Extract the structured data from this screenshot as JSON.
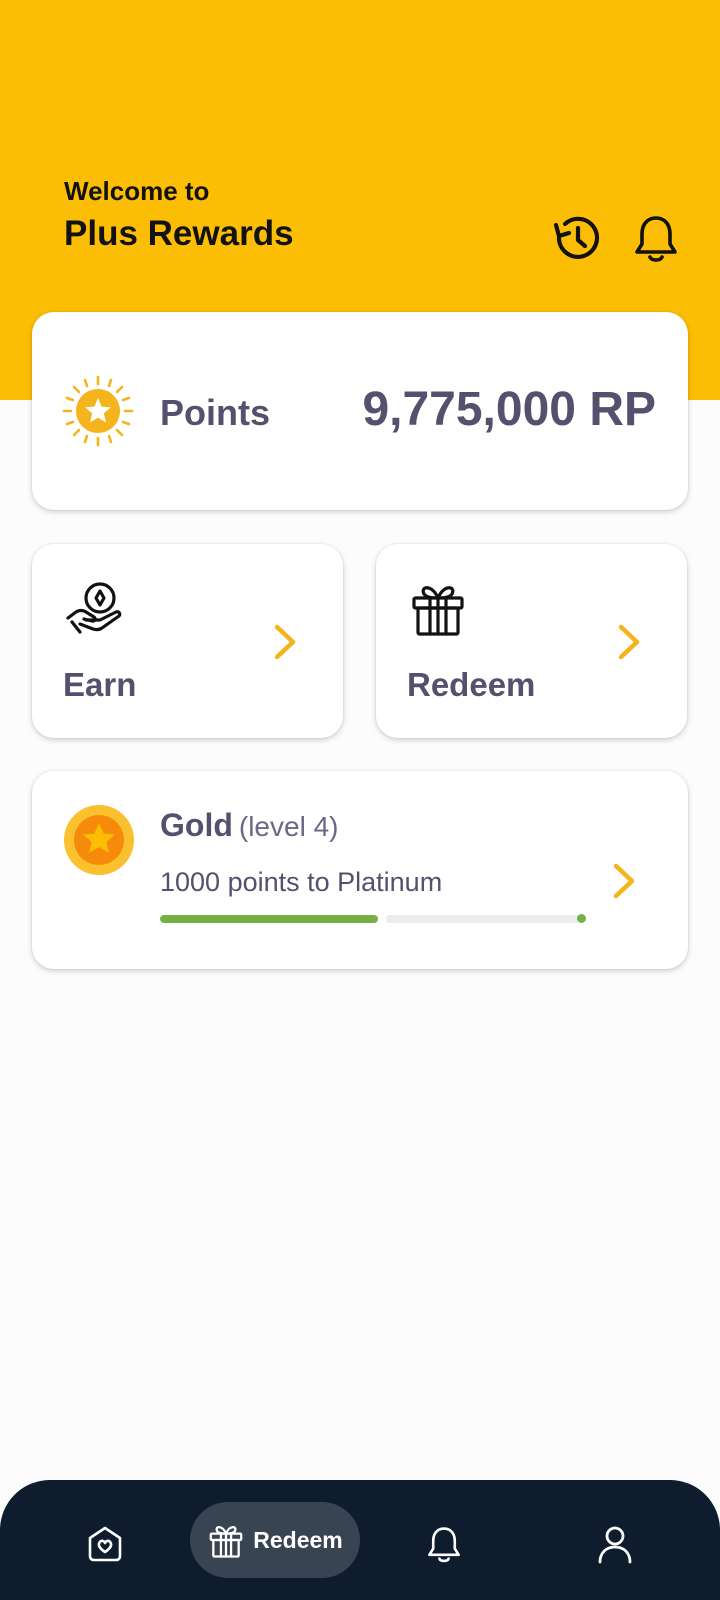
{
  "header": {
    "welcome": "Welcome to",
    "app_name": "Plus Rewards",
    "icons": [
      "history-icon",
      "bell-icon"
    ]
  },
  "points": {
    "label": "Points",
    "value": "9,775,000 RP",
    "icon": "sun-star-icon"
  },
  "actions": [
    {
      "label": "Earn",
      "icon": "hand-coin-icon"
    },
    {
      "label": "Redeem",
      "icon": "gift-icon"
    }
  ],
  "level": {
    "tier": "Gold",
    "level_text": "(level 4)",
    "progress_text": "1000 points to Platinum",
    "progress_fraction": 0.52,
    "icon": "gold-medal-icon"
  },
  "bottom_nav": {
    "active_label": "Redeem",
    "items": [
      "home-heart-icon",
      "gift-icon",
      "bell-icon",
      "profile-icon"
    ]
  },
  "colors": {
    "header": "#fcbd05",
    "accent_yellow": "#f5b31c",
    "text": "#55506e",
    "progress": "#74b043",
    "nav_bg": "#0e1c2d"
  }
}
